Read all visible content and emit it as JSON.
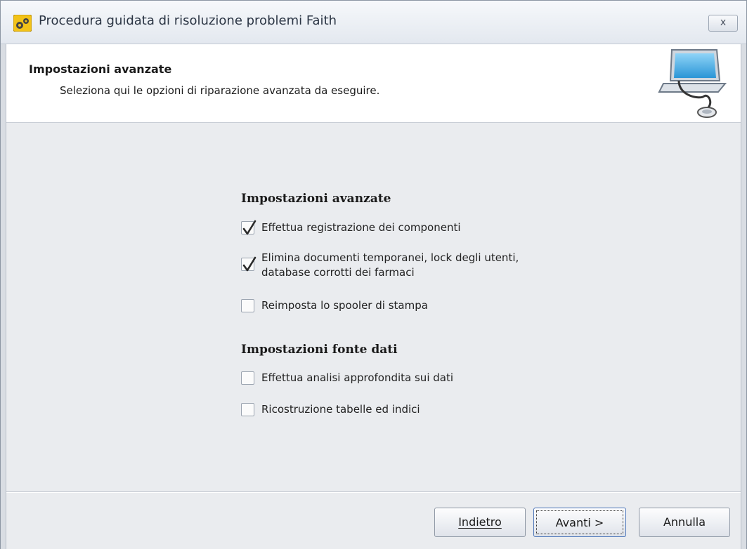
{
  "window": {
    "title": "Procedura guidata di risoluzione problemi Faith",
    "close_label": "x"
  },
  "header": {
    "title": "Impostazioni avanzate",
    "subtitle": "Seleziona qui le opzioni di riparazione avanzata da eseguire."
  },
  "groups": [
    {
      "title": "Impostazioni avanzate",
      "options": [
        {
          "label_lines": [
            "Effettua registrazione dei componenti"
          ],
          "checked": true
        },
        {
          "label_lines": [
            "Elimina documenti temporanei, lock degli utenti,",
            "database corrotti dei farmaci"
          ],
          "checked": true
        },
        {
          "label_lines": [
            "Reimposta lo spooler di stampa"
          ],
          "checked": false
        }
      ]
    },
    {
      "title": "Impostazioni fonte dati",
      "options": [
        {
          "label_lines": [
            "Effettua analisi approfondita sui dati"
          ],
          "checked": false
        },
        {
          "label_lines": [
            "Ricostruzione tabelle ed indici"
          ],
          "checked": false
        }
      ]
    }
  ],
  "buttons": {
    "back_label": "Indietro",
    "next_label": "Avanti >",
    "cancel_label": "Annulla"
  },
  "colors": {
    "header_bg": "#ffffff",
    "body_bg": "#eaecef",
    "focus_border": "#4a74b8"
  }
}
